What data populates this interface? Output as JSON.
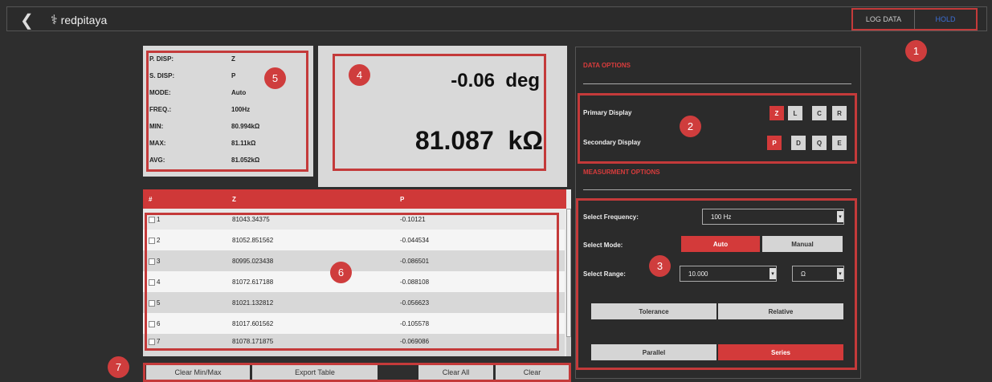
{
  "header": {
    "back_icon": "chevron-left-icon",
    "logo_text": "redpitaya",
    "logo_icon": "redpitaya-logo-icon",
    "log_data_label": "LOG DATA",
    "hold_label": "HOLD"
  },
  "callouts": [
    "1",
    "2",
    "3",
    "4",
    "5",
    "6",
    "7"
  ],
  "info": [
    {
      "key": "P. DISP:",
      "value": "Z"
    },
    {
      "key": "S. DISP:",
      "value": "P"
    },
    {
      "key": "MODE:",
      "value": "Auto"
    },
    {
      "key": "FREQ.:",
      "value": "100Hz"
    },
    {
      "key": "MIN:",
      "value": "80.994kΩ"
    },
    {
      "key": "MAX:",
      "value": "81.11kΩ"
    },
    {
      "key": "AVG:",
      "value": "81.052kΩ"
    }
  ],
  "display": {
    "secondary_value": "-0.06",
    "secondary_unit": "deg",
    "primary_value": "81.087",
    "primary_unit": "kΩ"
  },
  "data_options": {
    "title": "DATA OPTIONS",
    "primary_label": "Primary Display",
    "primary_buttons": [
      "Z",
      "L",
      "C",
      "R"
    ],
    "primary_selected": "Z",
    "secondary_label": "Secondary Display",
    "secondary_buttons": [
      "P",
      "D",
      "Q",
      "E"
    ],
    "secondary_selected": "P"
  },
  "measurement_options": {
    "title": "MEASURMENT OPTIONS",
    "frequency_label": "Select Frequency:",
    "frequency_value": "100 Hz",
    "mode_label": "Select Mode:",
    "mode_auto": "Auto",
    "mode_manual": "Manual",
    "range_label": "Select Range:",
    "range_value": "10.000",
    "range_unit": "Ω",
    "tolerance_label": "Tolerance",
    "relative_label": "Relative",
    "parallel_label": "Parallel",
    "series_label": "Series"
  },
  "table": {
    "headers": [
      "#",
      "Z",
      "P"
    ],
    "rows": [
      {
        "n": "1",
        "z": "81043.34375",
        "p": "-0.10121"
      },
      {
        "n": "2",
        "z": "81052.851562",
        "p": "-0.044534"
      },
      {
        "n": "3",
        "z": "80995.023438",
        "p": "-0.086501"
      },
      {
        "n": "4",
        "z": "81072.617188",
        "p": "-0.088108"
      },
      {
        "n": "5",
        "z": "81021.132812",
        "p": "-0.056623"
      },
      {
        "n": "6",
        "z": "81017.601562",
        "p": "-0.105578"
      },
      {
        "n": "7",
        "z": "81078.171875",
        "p": "-0.069086"
      }
    ]
  },
  "bottom_buttons": {
    "clear_minmax": "Clear Min/Max",
    "export_table": "Export Table",
    "clear_all": "Clear All",
    "clear": "Clear"
  },
  "colors": {
    "accent_red": "#d33a3a",
    "hold_blue": "#3d6fd6",
    "background": "#2e2e2e"
  }
}
